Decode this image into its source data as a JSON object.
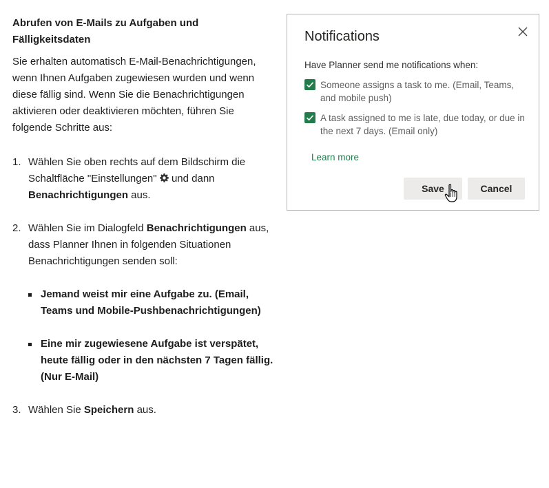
{
  "article": {
    "heading": "Abrufen von E-Mails zu Aufgaben und Fälligkeitsdaten",
    "intro": "Sie erhalten automatisch E-Mail-Benachrichtigungen, wenn Ihnen Aufgaben zugewiesen wurden und wenn diese fällig sind. Wenn Sie die Benachrichtigungen aktivieren oder deaktivieren möchten, führen Sie folgende Schritte aus:",
    "steps": [
      {
        "num": "1.",
        "text_a": "Wählen Sie oben rechts auf dem Bildschirm die Schaltfläche \"Einstellungen\" ",
        "icon": "gear-icon",
        "text_b": " und dann ",
        "bold": "Benachrichtigungen",
        "text_c": " aus."
      },
      {
        "num": "2.",
        "text_a": "Wählen Sie im Dialogfeld ",
        "bold": "Benachrichtigungen",
        "text_b": " aus, dass Planner Ihnen in folgenden Situationen Benachrichtigungen senden soll:",
        "bullets": [
          "Jemand weist mir eine Aufgabe zu. (Email, Teams und Mobile-Pushbenachrichtigungen)",
          "Eine mir zugewiesene Aufgabe ist verspätet, heute fällig oder in den nächsten 7 Tagen fällig. (Nur E-Mail)"
        ]
      },
      {
        "num": "3.",
        "text_a": "Wählen Sie ",
        "bold": "Speichern",
        "text_b": " aus."
      }
    ]
  },
  "dialog": {
    "title": "Notifications",
    "subtitle": "Have Planner send me notifications when:",
    "options": [
      {
        "label": "Someone assigns a task to me. (Email, Teams, and mobile push)",
        "checked": true
      },
      {
        "label": "A task assigned to me is late, due today, or due in the next 7 days. (Email only)",
        "checked": true
      }
    ],
    "learn_more": "Learn more",
    "save_label": "Save",
    "cancel_label": "Cancel",
    "accent_color": "#237b4b"
  }
}
